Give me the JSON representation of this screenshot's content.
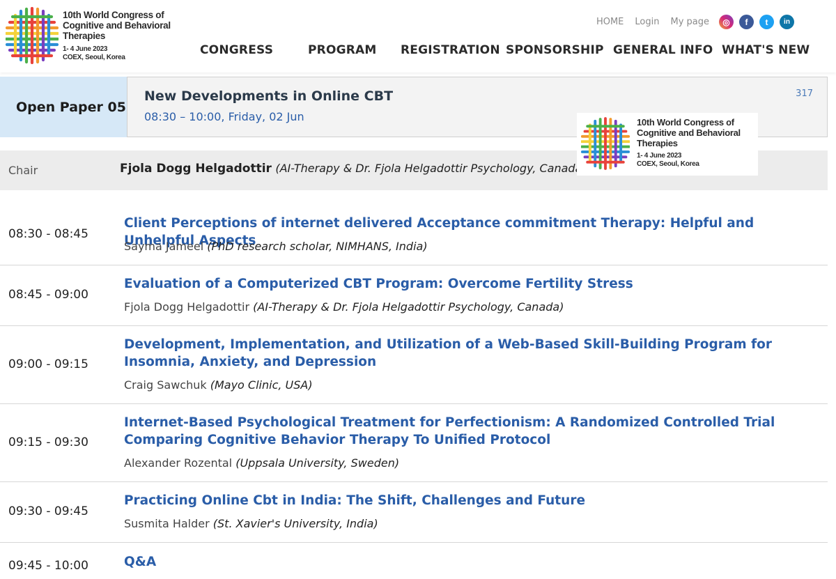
{
  "brand": {
    "line1": "10th World Congress of",
    "line2": "Cognitive and Behavioral",
    "line3": "Therapies",
    "dates": "1- 4 June 2023",
    "venue": "COEX, Seoul, Korea",
    "colors": [
      "#e8423b",
      "#f29a2e",
      "#f5d23a",
      "#4bb04a",
      "#2a8fd6",
      "#7a3fbf"
    ]
  },
  "top_links": [
    "HOME",
    "Login",
    "My page"
  ],
  "social": [
    {
      "icon": "instagram-icon",
      "glyph": "◎"
    },
    {
      "icon": "facebook-icon",
      "glyph": "f"
    },
    {
      "icon": "twitter-icon",
      "glyph": "t"
    },
    {
      "icon": "linkedin-icon",
      "glyph": "in"
    }
  ],
  "nav": [
    "CONGRESS",
    "PROGRAM",
    "REGISTRATION",
    "SPONSORSHIP",
    "GENERAL INFO",
    "WHAT'S NEW"
  ],
  "session": {
    "label": "Open Paper 05",
    "title": "New Developments in Online CBT",
    "time": "08:30 – 10:00, Friday, 02 Jun",
    "number": "317"
  },
  "chair": {
    "label": "Chair",
    "name": "Fjola Dogg Helgadottir",
    "affiliation": "(AI-Therapy & Dr. Fjola Helgadottir Psychology, Canada)"
  },
  "talks": [
    {
      "time": "08:30 - 08:45",
      "title": "Client Perceptions of internet delivered Acceptance commitment Therapy: Helpful and Unhelpful Aspects",
      "author": "Sayma Jameel",
      "affiliation": "(PhD research scholar, NIMHANS, India)"
    },
    {
      "time": "08:45 - 09:00",
      "title": "Evaluation of a Computerized CBT Program: Overcome Fertility Stress",
      "author": "Fjola Dogg Helgadottir",
      "affiliation": "(AI-Therapy & Dr. Fjola Helgadottir Psychology, Canada)"
    },
    {
      "time": "09:00 - 09:15",
      "title": "Development, Implementation, and Utilization of a Web-Based Skill-Building Program for Insomnia, Anxiety, and Depression",
      "author": "Craig Sawchuk",
      "affiliation": "(Mayo Clinic, USA)"
    },
    {
      "time": "09:15 - 09:30",
      "title": "Internet-Based Psychological Treatment for Perfectionism: A Randomized Controlled Trial Comparing Cognitive Behavior Therapy To Unified Protocol",
      "author": "Alexander Rozental",
      "affiliation": "(Uppsala University, Sweden)"
    },
    {
      "time": "09:30 - 09:45",
      "title": "Practicing Online Cbt in India: The Shift, Challenges and Future",
      "author": "Susmita Halder",
      "affiliation": "(St. Xavier's University, India)"
    },
    {
      "time": "09:45 - 10:00",
      "title": "Q&A",
      "author": "",
      "affiliation": ""
    }
  ]
}
